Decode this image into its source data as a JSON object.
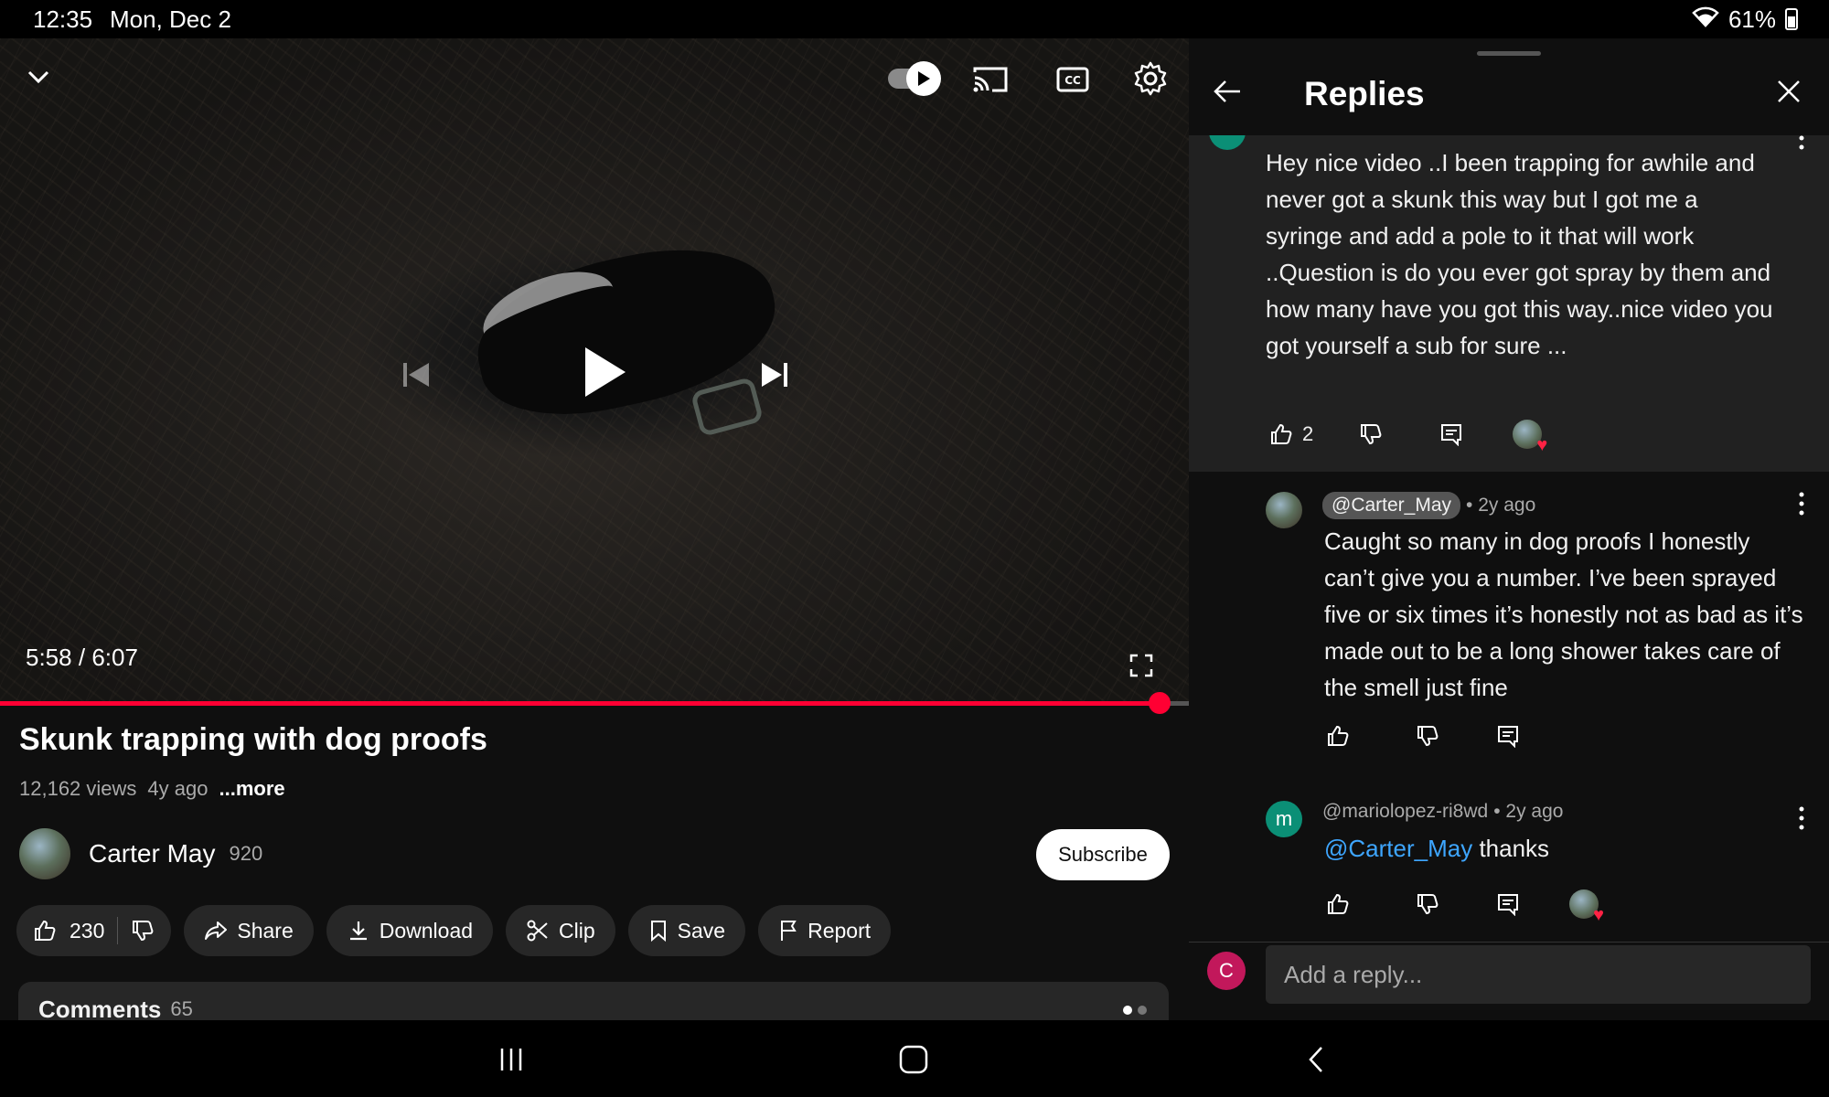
{
  "status_bar": {
    "time": "12:35",
    "date": "Mon, Dec 2",
    "battery": "61%"
  },
  "player": {
    "current_time": "5:58",
    "separator": "/",
    "duration": "6:07",
    "progress_fraction": 0.975
  },
  "video": {
    "title": "Skunk trapping with dog proofs",
    "views": "12,162 views",
    "age": "4y ago",
    "more": "...more"
  },
  "channel": {
    "name": "Carter May",
    "subscribers": "920",
    "subscribe_label": "Subscribe"
  },
  "actions": {
    "likes": "230",
    "share": "Share",
    "download": "Download",
    "clip": "Clip",
    "save": "Save",
    "report": "Report"
  },
  "comments_bar": {
    "label": "Comments",
    "count": "65"
  },
  "replies_panel": {
    "title": "Replies",
    "parent_comment": {
      "text": "Hey  nice video ..I been trapping for awhile and never got a skunk this way but I got me a syringe  and add a pole to it that will work ..Question is do you ever got spray by them and how many have you got this way..nice video you got yourself a sub for sure ...",
      "likes": "2"
    },
    "replies": [
      {
        "handle": "@Carter_May",
        "age": "• 2y ago",
        "text": "Caught so many in dog proofs I honestly can’t give you a number. I’ve been sprayed five or six times it’s honestly not as bad as it’s made out to be a long shower takes care of the smell just fine"
      },
      {
        "avatar_letter": "m",
        "handle": "@mariolopez-ri8wd",
        "age": "• 2y ago",
        "mention": "@Carter_May",
        "text": " thanks"
      }
    ],
    "composer": {
      "avatar_letter": "C",
      "placeholder": "Add a reply..."
    }
  },
  "colors": {
    "accent": "#ff0033",
    "link": "#3ea6ff",
    "background": "#0f0f0f"
  }
}
